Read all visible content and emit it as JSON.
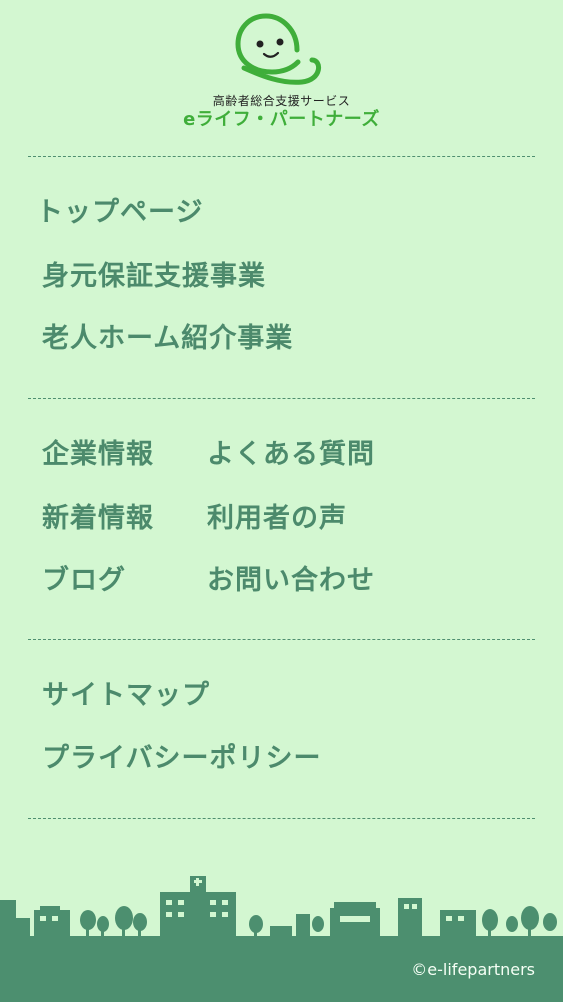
{
  "logo": {
    "subtitle": "高齢者総合支援サービス",
    "brand": "eライフ・パートナーズ"
  },
  "nav": {
    "primary": [
      "トップページ",
      "身元保証支援事業",
      "老人ホーム紹介事業"
    ],
    "left": [
      "企業情報",
      "新着情報",
      "ブログ"
    ],
    "right": [
      "よくある質問",
      "利用者の声",
      "お問い合わせ"
    ],
    "tertiary": [
      "サイトマップ",
      "プライバシーポリシー"
    ]
  },
  "footer": {
    "copyright": "©e-lifepartners"
  },
  "colors": {
    "background": "#d3f7d1",
    "link": "#4c8a6c",
    "brand": "#3fae3a",
    "footer": "#4c8f6f"
  }
}
